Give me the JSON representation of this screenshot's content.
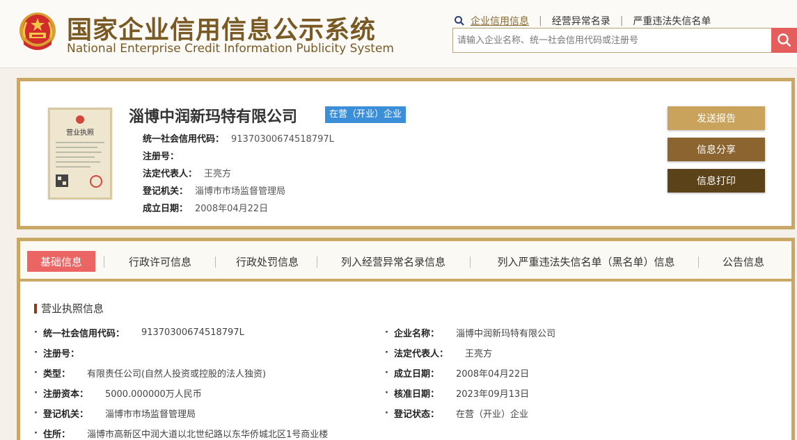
{
  "header": {
    "title_cn": "国家企业信用信息公示系统",
    "title_en": "National Enterprise Credit Information Publicity System",
    "nav": [
      "企业信用信息",
      "经营异常名录",
      "严重违法失信名单"
    ],
    "search_placeholder": "请输入企业名称、统一社会信用代码或注册号"
  },
  "company": {
    "name": "淄博中润新玛特有限公司",
    "status": "在营（开业）企业",
    "fields": [
      {
        "label": "统一社会信用代码：",
        "value": "91370300674518797L"
      },
      {
        "label": "注册号：",
        "value": ""
      },
      {
        "label": "法定代表人：",
        "value": "王亮方"
      },
      {
        "label": "登记机关：",
        "value": "淄博市市场监督管理局"
      },
      {
        "label": "成立日期：",
        "value": "2008年04月22日"
      }
    ],
    "license_image_title": "营业执照"
  },
  "actions": {
    "send_report": "发送报告",
    "share": "信息分享",
    "print": "信息打印"
  },
  "colors": {
    "accent_gold": "#c9a866",
    "send_btn": "#c9a35c",
    "share_btn": "#8b6430",
    "print_btn": "#5c4218",
    "badge_blue": "#3b8fd9",
    "tab_active": "#ec6565"
  },
  "tabs": [
    "基础信息",
    "行政许可信息",
    "行政处罚信息",
    "列入经营异常名录信息",
    "列入严重违法失信名单（黑名单）信息",
    "公告信息"
  ],
  "basic_info": {
    "section_title": "营业执照信息",
    "left": [
      {
        "label": "统一社会信用代码：",
        "value": "91370300674518797L"
      },
      {
        "label": "注册号：",
        "value": ""
      },
      {
        "label": "类型：",
        "value": "有限责任公司(自然人投资或控股的法人独资)"
      },
      {
        "label": "注册资本：",
        "value": "5000.000000万人民币"
      },
      {
        "label": "登记机关：",
        "value": "淄博市市场监督管理局"
      },
      {
        "label": "住所：",
        "value": "淄博市高新区中润大道以北世纪路以东华侨城北区1号商业楼"
      }
    ],
    "right": [
      {
        "label": "企业名称：",
        "value": "淄博中润新玛特有限公司"
      },
      {
        "label": "法定代表人：",
        "value": "王亮方"
      },
      {
        "label": "成立日期：",
        "value": "2008年04月22日"
      },
      {
        "label": "核准日期：",
        "value": "2023年09月13日"
      },
      {
        "label": "登记状态：",
        "value": "在营（开业）企业"
      }
    ]
  }
}
